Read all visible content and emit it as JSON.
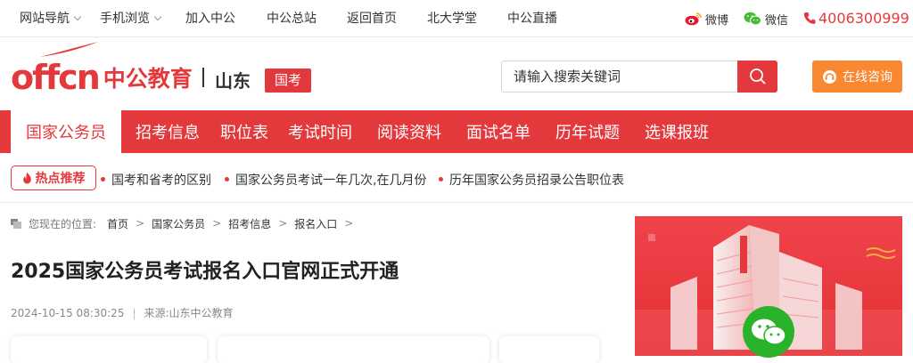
{
  "topbar": {
    "nav": [
      "网站导航",
      "手机浏览",
      "加入中公",
      "中公总站",
      "返回首页",
      "北大学堂",
      "中公直播"
    ],
    "weibo": "微博",
    "weixin": "微信",
    "phone": "4006300999"
  },
  "header": {
    "logo_en": "offcn",
    "logo_zh": "中公教育",
    "province": "山东",
    "tag": "国考",
    "search_placeholder": "请输入搜索关键词",
    "consult": "在线咨询"
  },
  "mainnav": [
    "国家公务员",
    "招考信息",
    "职位表",
    "考试时间",
    "阅读资料",
    "面试名单",
    "历年试题",
    "选课报班"
  ],
  "hot": {
    "label": "热点推荐",
    "links": [
      "国考和省考的区别",
      "国家公务员考试一年几次,在几月份",
      "历年国家公务员招录公告职位表"
    ]
  },
  "breadcrumb": {
    "label": "您现在的位置:",
    "items": [
      "首页",
      "国家公务员",
      "招考信息",
      "报名入口"
    ]
  },
  "article": {
    "title": "2025国家公务员考试报名入口官网正式开通",
    "date": "2024-10-15 08:30:25",
    "source": "来源:山东中公教育"
  },
  "colors": {
    "brand_red": "#e4393c",
    "consult_orange": "#fa8731",
    "wechat_green": "#2ab32a"
  }
}
